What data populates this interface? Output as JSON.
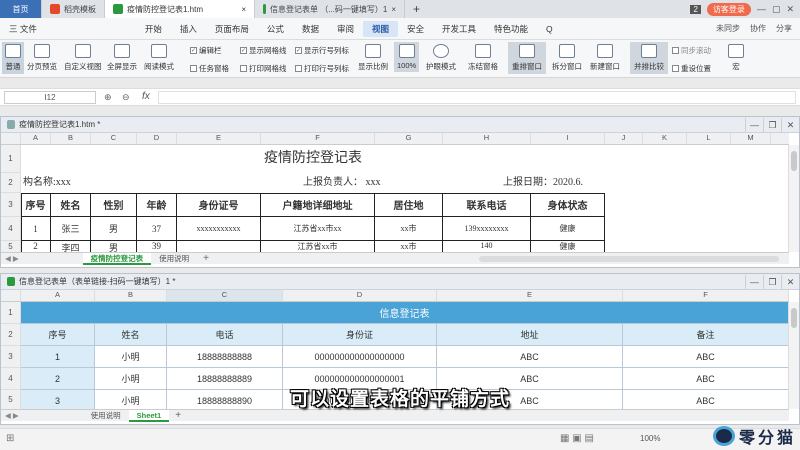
{
  "tabs": {
    "home": "首页",
    "items": [
      {
        "label": "稻壳模板",
        "color": "#e24a2b"
      },
      {
        "label": "疫情防控登记表1.htm",
        "color": "#2b9a3e",
        "close": "×"
      },
      {
        "label": "信息登记表单 （...码一键填写）1",
        "color": "#2b9a3e",
        "close": "×"
      }
    ],
    "add": "+",
    "count": "2",
    "visitor": "访客登录"
  },
  "menu": {
    "file": "三 文件",
    "items": [
      "开始",
      "插入",
      "页面布局",
      "公式",
      "数据",
      "审阅",
      "视图",
      "安全",
      "开发工具",
      "特色功能"
    ],
    "active_index": 6,
    "search": "Q",
    "right": [
      "未同步",
      "协作",
      "分享"
    ]
  },
  "ribbon": {
    "buttons": [
      "普通",
      "分页预览",
      "自定义视图",
      "全屏显示",
      "阅读模式"
    ],
    "checks": [
      {
        "label": "编辑栏",
        "checked": true
      },
      {
        "label": "显示网格线",
        "checked": true
      },
      {
        "label": "显示行号列标",
        "checked": true
      },
      {
        "label": "任务窗格",
        "checked": false
      },
      {
        "label": "打印网格线",
        "checked": false
      },
      {
        "label": "打印行号列标",
        "checked": false
      }
    ],
    "right_buttons": [
      "显示比例",
      "100%",
      "护眼模式",
      "冻结窗格",
      "重排窗口",
      "拆分窗口",
      "新建窗口",
      "并排比较",
      "同步滚动",
      "重设位置",
      "宏"
    ]
  },
  "formula": {
    "namebox": "I12",
    "fx": "fx"
  },
  "win1": {
    "title": "疫情防控登记表1.htm *",
    "cols": [
      "A",
      "B",
      "C",
      "D",
      "E",
      "F",
      "G",
      "H",
      "I",
      "J",
      "K",
      "L",
      "M"
    ],
    "rows": [
      "1",
      "2",
      "3",
      "4",
      "5"
    ],
    "doc_title": "疫情防控登记表",
    "row2": {
      "org": "构名称:xxx",
      "reporter": "上报负责人：  xxx",
      "date": "上报日期：2020.6."
    },
    "headers": [
      "序号",
      "姓名",
      "性别",
      "年龄",
      "身份证号",
      "户籍地详细地址",
      "居住地",
      "联系电话",
      "身体状态"
    ],
    "row4": [
      "1",
      "张三",
      "男",
      "37",
      "xxxxxxxxxxx",
      "江苏省xx市xx",
      "xx市",
      "139xxxxxxxx",
      "健康"
    ],
    "row5": [
      "2",
      "李四",
      "男",
      "39",
      "",
      "江苏省xx市",
      "xx市",
      "140",
      "健康"
    ],
    "sheets": [
      "疫情防控登记表",
      "使用说明"
    ]
  },
  "win2": {
    "title": "信息登记表单（表单链接-扫码一键填写）1 *",
    "cols": [
      "A",
      "B",
      "C",
      "D",
      "E",
      "F"
    ],
    "rows": [
      "1",
      "2",
      "3",
      "4",
      "5"
    ],
    "header": "信息登记表",
    "columns": [
      "序号",
      "姓名",
      "电话",
      "身份证",
      "地址",
      "备注"
    ],
    "data": [
      [
        "1",
        "小明",
        "18888888888",
        "000000000000000000",
        "ABC",
        "ABC"
      ],
      [
        "2",
        "小明",
        "18888888889",
        "000000000000000001",
        "ABC",
        "ABC"
      ],
      [
        "3",
        "小明",
        "18888888890",
        "000000000000000002",
        "ABC",
        "ABC"
      ]
    ],
    "sheets": [
      "使用说明",
      "Sheet1"
    ]
  },
  "status": {
    "zoom": "100%"
  },
  "subtitle": "可以设置表格的平铺方式",
  "logo": "零分猫"
}
